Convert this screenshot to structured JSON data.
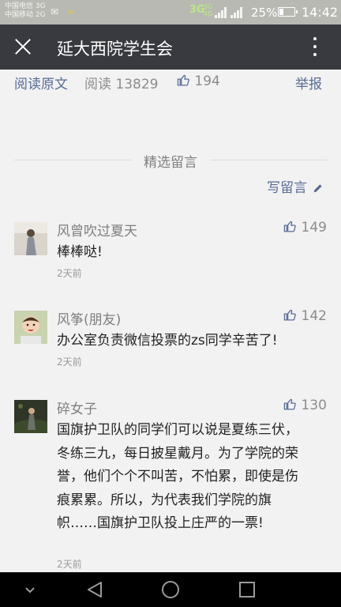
{
  "status_bar": {
    "carrier_1": "中国电信 3G",
    "carrier_2": "中国移动 2G",
    "network": "3G",
    "network_2": "3G 4G",
    "battery": "25%",
    "time": "14:42"
  },
  "app_bar": {
    "title": "延大西院学生会"
  },
  "article_footer": {
    "read_original": "阅读原文",
    "read_count": "阅读 13829",
    "likes": "194",
    "report": "举报"
  },
  "comments_section": {
    "header": "精选留言",
    "write_label": "写留言"
  },
  "comments": [
    {
      "name": "风曾吹过夏天",
      "likes": "149",
      "text": "棒棒哒!",
      "time": "2天前"
    },
    {
      "name": "风筝(朋友)",
      "likes": "142",
      "text": "办公室负责微信投票的zs同学辛苦了!",
      "time": "2天前"
    },
    {
      "name": "碎女子",
      "likes": "130",
      "text": "国旗护卫队的同学们可以说是夏练三伏，冬练三九，每日披星戴月。为了学院的荣誉，他们个个不叫苦，不怕累，即使是伤痕累累。所以，为代表我们学院的旗帜……国旗护卫队投上庄严的一票!",
      "time": "2天前"
    }
  ],
  "colors": {
    "link": "#576b95",
    "app_bar": "#393a3f",
    "status_bar": "#b9b9b3",
    "background": "#f2f2f2"
  },
  "icons": [
    "close-icon",
    "more-icon",
    "thumb-up-icon",
    "pencil-icon",
    "back-icon",
    "home-icon",
    "recents-icon",
    "chevron-down-icon"
  ]
}
